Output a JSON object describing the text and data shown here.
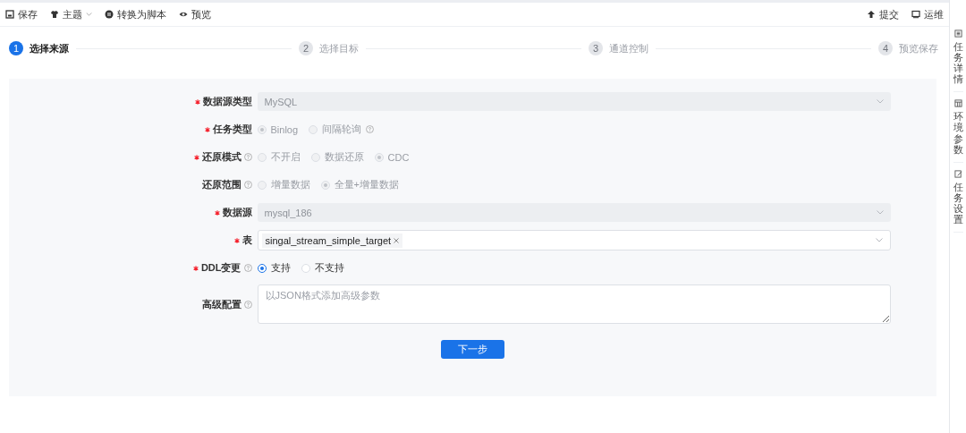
{
  "toolbar": {
    "left": [
      {
        "label": "保存",
        "dropdown": false
      },
      {
        "label": "主题",
        "dropdown": true
      },
      {
        "label": "转换为脚本",
        "dropdown": false
      },
      {
        "label": "预览",
        "dropdown": false
      }
    ],
    "right": [
      {
        "label": "提交"
      },
      {
        "label": "运维"
      }
    ]
  },
  "steps": [
    {
      "number": "1",
      "label": "选择来源",
      "selected": true
    },
    {
      "number": "2",
      "label": "选择目标",
      "selected": false
    },
    {
      "number": "3",
      "label": "通道控制",
      "selected": false
    },
    {
      "number": "4",
      "label": "预览保存",
      "selected": false
    }
  ],
  "side_tabs": [
    {
      "label": "任务详情"
    },
    {
      "label": "环境参数"
    },
    {
      "label": "任务设置"
    }
  ],
  "form": {
    "fields": [
      {
        "kind": "select",
        "label": "数据源类型",
        "required": true,
        "help": false,
        "disabled": true,
        "value": "MySQL"
      },
      {
        "kind": "radio",
        "label": "任务类型",
        "required": true,
        "help": false,
        "disabled": true,
        "options": [
          {
            "label": "Binlog",
            "selected": true,
            "help": false
          },
          {
            "label": "间隔轮询",
            "selected": false,
            "help": true
          }
        ]
      },
      {
        "kind": "radio",
        "label": "还原模式",
        "required": true,
        "help": true,
        "disabled": true,
        "options": [
          {
            "label": "不开启",
            "selected": false,
            "help": false
          },
          {
            "label": "数据还原",
            "selected": false,
            "help": false
          },
          {
            "label": "CDC",
            "selected": true,
            "help": false
          }
        ]
      },
      {
        "kind": "radio",
        "label": "还原范围",
        "required": false,
        "help": true,
        "disabled": true,
        "options": [
          {
            "label": "增量数据",
            "selected": false,
            "help": false
          },
          {
            "label": "全量+增量数据",
            "selected": true,
            "help": false
          }
        ]
      },
      {
        "kind": "select",
        "label": "数据源",
        "required": true,
        "help": false,
        "disabled": true,
        "value": "mysql_186"
      },
      {
        "kind": "tags",
        "label": "表",
        "required": true,
        "help": false,
        "disabled": false,
        "tags": [
          "singal_stream_simple_target"
        ]
      },
      {
        "kind": "radio",
        "label": "DDL变更",
        "required": true,
        "help": true,
        "disabled": false,
        "options": [
          {
            "label": "支持",
            "selected": true,
            "help": false
          },
          {
            "label": "不支持",
            "selected": false,
            "help": false
          }
        ]
      },
      {
        "kind": "textarea",
        "label": "高级配置",
        "required": false,
        "help": true,
        "disabled": false,
        "placeholder": "以JSON格式添加高级参数"
      }
    ],
    "submit": "下一步"
  }
}
